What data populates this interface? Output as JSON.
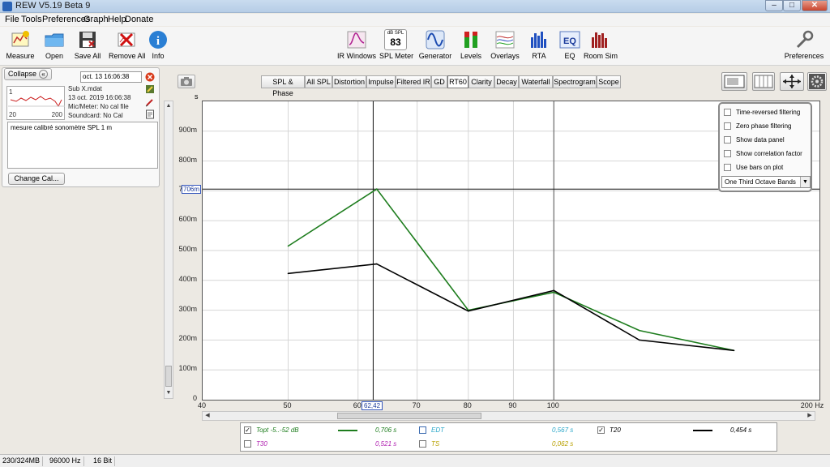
{
  "window": {
    "title": "REW V5.19 Beta 9"
  },
  "menu": [
    "File",
    "Tools",
    "Preferences",
    "Graph",
    "Help",
    "Donate"
  ],
  "toolbar": {
    "measure": "Measure",
    "open": "Open",
    "save_all": "Save All",
    "remove_all": "Remove All",
    "info": "Info",
    "ir_windows": "IR Windows",
    "spl_meter": "SPL Meter",
    "spl_meter_unit": "dB SPL",
    "spl_meter_value": "83",
    "generator": "Generator",
    "levels": "Levels",
    "overlays": "Overlays",
    "rta": "RTA",
    "eq": "EQ",
    "room_sim": "Room Sim",
    "preferences": "Preferences"
  },
  "panel": {
    "collapse": "Collapse",
    "date_field": "oct. 13 16:06:38",
    "file_name": "Sub X.mdat",
    "date": "13 oct. 2019 16:06:38",
    "mic": "Mic/Meter: No cal file",
    "soundcard": "Soundcard: No Cal",
    "notes": "mesure calibré sonomètre SPL 1 m",
    "change_cal": "Change Cal...",
    "mini_y": "1",
    "mini_x_left": "20",
    "mini_x_right": "200"
  },
  "tabs": [
    "SPL & Phase",
    "All SPL",
    "Distortion",
    "Impulse",
    "Filtered IR",
    "GD",
    "RT60",
    "Clarity",
    "Decay",
    "Waterfall",
    "Spectrogram",
    "Scope"
  ],
  "active_tab": "RT60",
  "graph": {
    "y_unit": "s",
    "y_ticks": [
      "0",
      "100m",
      "200m",
      "300m",
      "400m",
      "500m",
      "600m",
      "700m",
      "800m",
      "900m"
    ],
    "x_ticks": [
      "40",
      "50",
      "60",
      "70",
      "80",
      "90",
      "100",
      "200 Hz"
    ],
    "cursor_y": "706m",
    "cursor_x": "62,42"
  },
  "options": {
    "items": [
      "Time-reversed filtering",
      "Zero phase filtering",
      "Show data panel",
      "Show correlation factor",
      "Use bars on plot"
    ],
    "bands": "One Third Octave Bands"
  },
  "legend": [
    {
      "label": "Topt -5..-52 dB",
      "value": "0,706 s",
      "checked": true,
      "color": "#1e7d1e"
    },
    {
      "label": "EDT",
      "value": "0,567 s",
      "checked": false,
      "color": "#2aa7c9"
    },
    {
      "label": "T20",
      "value": "0,454 s",
      "checked": true,
      "color": "#000000"
    },
    {
      "label": "T30",
      "value": "0,521 s",
      "checked": false,
      "color": "#b020b0"
    },
    {
      "label": "TS",
      "value": "0,062 s",
      "checked": false,
      "color": "#b8a000"
    }
  ],
  "status": {
    "memory": "230/324MB",
    "rate": "96000 Hz",
    "bits": "16 Bit"
  },
  "chart_data": {
    "type": "line",
    "xlabel": "Hz",
    "ylabel": "s",
    "x_scale": "log",
    "xlim": [
      40,
      200
    ],
    "ylim": [
      0,
      1.0
    ],
    "grid": true,
    "series": [
      {
        "name": "Topt -5..-52 dB",
        "color": "#1e7d1e",
        "x": [
          50,
          63,
          80,
          100,
          125,
          160
        ],
        "y": [
          0.515,
          0.706,
          0.3,
          0.36,
          0.232,
          0.165
        ]
      },
      {
        "name": "T20",
        "color": "#000000",
        "x": [
          50,
          63,
          80,
          100,
          125,
          160
        ],
        "y": [
          0.423,
          0.455,
          0.297,
          0.366,
          0.2,
          0.165
        ]
      }
    ],
    "cursor": {
      "x": 62.42,
      "y": 0.706
    }
  }
}
